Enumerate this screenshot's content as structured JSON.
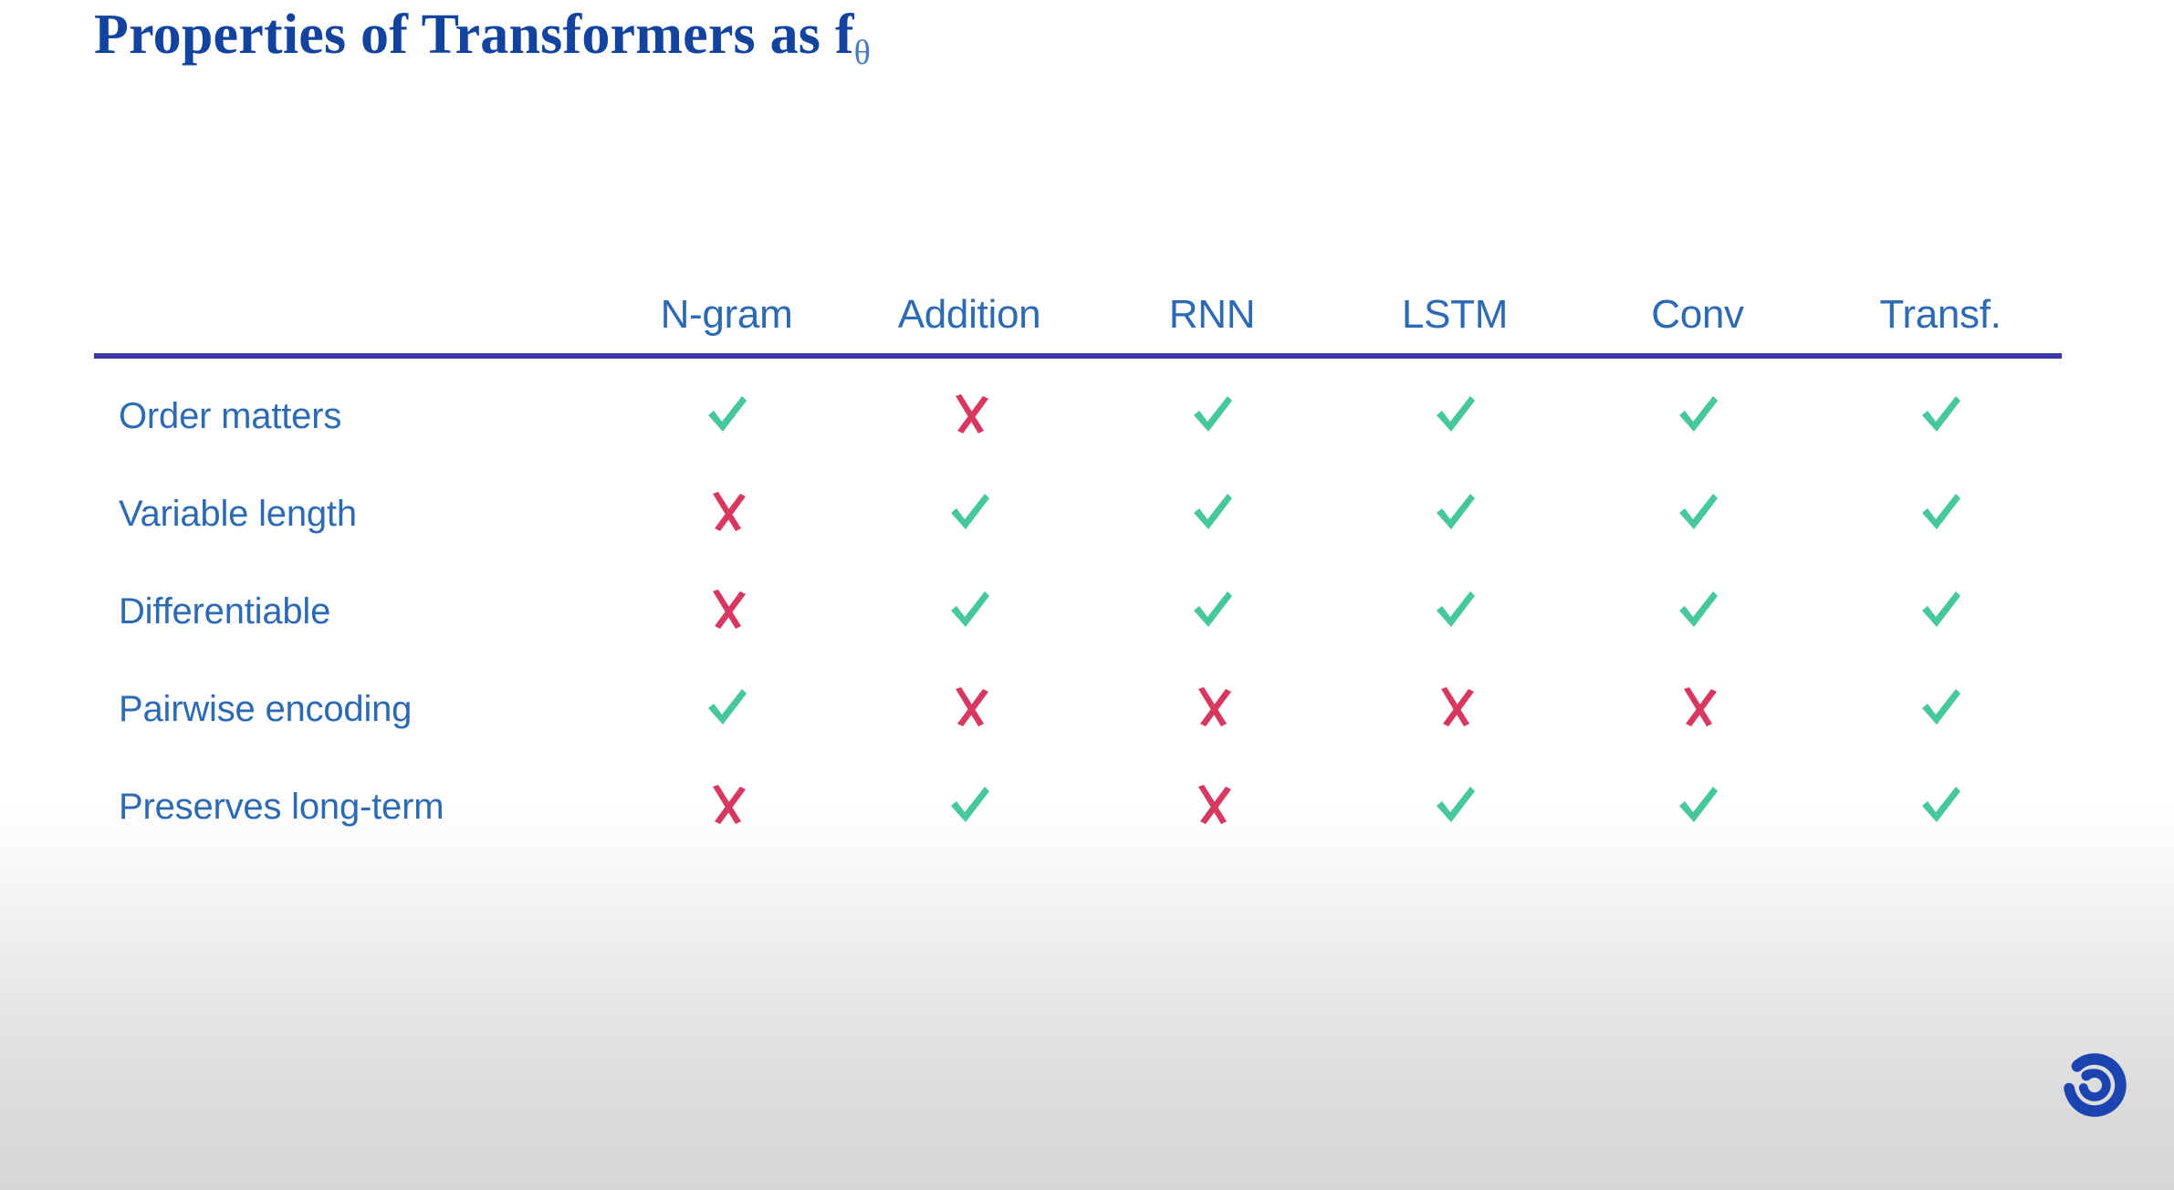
{
  "slide": {
    "title_main": "Properties of Transformers as f",
    "title_subscript": "θ",
    "background_top_color": "#ffffff",
    "background_bottom_color": "#d6d6d6"
  },
  "colors": {
    "title_blue": "#12439e",
    "theta_blue": "#4a7ac0",
    "text_blue": "#2d6ab4",
    "rule_blue": "#3b37a8",
    "check_green": "#46c89c",
    "cross_red": "#d6385f",
    "logo_blue": "#1b44b0"
  },
  "table": {
    "row_header_label": "",
    "columns": [
      "N-gram",
      "Addition",
      "RNN",
      "LSTM",
      "Conv",
      "Transf."
    ],
    "rows": [
      {
        "label": "Order matters",
        "values": [
          "check",
          "cross",
          "check",
          "check",
          "check",
          "check"
        ]
      },
      {
        "label": "Variable length",
        "values": [
          "cross",
          "check",
          "check",
          "check",
          "check",
          "check"
        ]
      },
      {
        "label": "Differentiable",
        "values": [
          "cross",
          "check",
          "check",
          "check",
          "check",
          "check"
        ]
      },
      {
        "label": "Pairwise encoding",
        "values": [
          "check",
          "cross",
          "cross",
          "cross",
          "cross",
          "check"
        ]
      },
      {
        "label": "Preserves long-term",
        "values": [
          "cross",
          "check",
          "cross",
          "check",
          "check",
          "check"
        ]
      }
    ]
  },
  "logo": {
    "name": "spiral-logo"
  }
}
